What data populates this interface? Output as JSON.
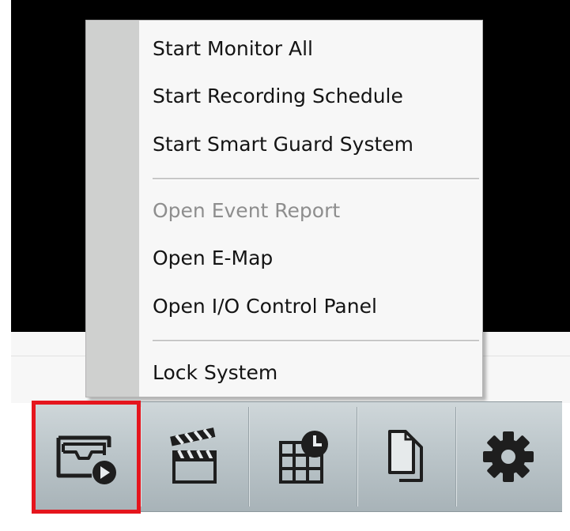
{
  "context_menu": {
    "group1": [
      {
        "label": "Start Monitor All",
        "enabled": true
      },
      {
        "label": "Start Recording Schedule",
        "enabled": true
      },
      {
        "label": "Start Smart Guard System",
        "enabled": true
      }
    ],
    "group2": [
      {
        "label": "Open Event Report",
        "enabled": false
      },
      {
        "label": "Open E-Map",
        "enabled": true
      },
      {
        "label": "Open I/O Control Panel",
        "enabled": true
      }
    ],
    "group3": [
      {
        "label": "Lock System",
        "enabled": true
      }
    ]
  },
  "toolbar": {
    "buttons": [
      {
        "icon": "folder-play-icon",
        "highlighted": true
      },
      {
        "icon": "clapperboard-icon",
        "highlighted": false
      },
      {
        "icon": "schedule-grid-clock-icon",
        "highlighted": false
      },
      {
        "icon": "documents-icon",
        "highlighted": false
      },
      {
        "icon": "gear-icon",
        "highlighted": false
      }
    ]
  },
  "colors": {
    "highlight": "#e5151d",
    "menu_background": "#f7f7f7",
    "menu_gutter": "#cfd0cf",
    "toolbar": "#bcc6ca",
    "disabled_text": "#8e8e8e"
  }
}
